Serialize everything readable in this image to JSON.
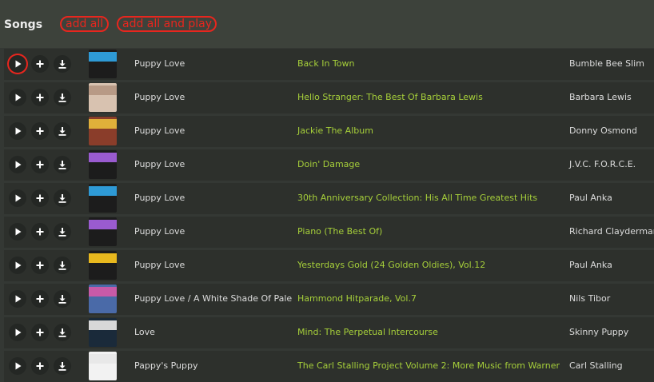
{
  "header": {
    "title": "Songs",
    "add_all_label": "add all",
    "add_all_play_label": "add all and play"
  },
  "rows": [
    {
      "song": "Puppy Love",
      "album": "Back In Town",
      "artist": "Bumble Bee Slim",
      "cover_color": "#2e9ad6",
      "cover_bg": "#1c1c1c"
    },
    {
      "song": "Puppy Love",
      "album": "Hello Stranger: The Best Of Barbara Lewis",
      "artist": "Barbara Lewis",
      "cover_color": "#b89a86",
      "cover_bg": "#d8c2b0"
    },
    {
      "song": "Puppy Love",
      "album": "Jackie The Album",
      "artist": "Donny Osmond",
      "cover_color": "#e0b03a",
      "cover_bg": "#8a3d2a"
    },
    {
      "song": "Puppy Love",
      "album": "Doin' Damage",
      "artist": "J.V.C. F.O.R.C.E.",
      "cover_color": "#9a5bd0",
      "cover_bg": "#1c1c1c"
    },
    {
      "song": "Puppy Love",
      "album": "30th Anniversary Collection: His All Time Greatest Hits",
      "artist": "Paul Anka",
      "cover_color": "#2e9ad6",
      "cover_bg": "#1c1c1c"
    },
    {
      "song": "Puppy Love",
      "album": "Piano (The Best Of)",
      "artist": "Richard Clayderman",
      "cover_color": "#9a5bd0",
      "cover_bg": "#1c1c1c"
    },
    {
      "song": "Puppy Love",
      "album": "Yesterdays Gold (24 Golden Oldies), Vol.12",
      "artist": "Paul Anka",
      "cover_color": "#e8b81e",
      "cover_bg": "#1c1c1c"
    },
    {
      "song": "Puppy Love / A White Shade Of Pale",
      "album": "Hammond Hitparade, Vol.7",
      "artist": "Nils Tibor",
      "cover_color": "#c85aa8",
      "cover_bg": "#4a6aa8"
    },
    {
      "song": "Love",
      "album": "Mind: The Perpetual Intercourse",
      "artist": "Skinny Puppy",
      "cover_color": "#d8d8d8",
      "cover_bg": "#1a2a3a"
    },
    {
      "song": "Pappy's Puppy",
      "album": "The Carl Stalling Project Volume 2: More Music from Warner",
      "artist": "Carl Stalling",
      "cover_color": "#e8e8e8",
      "cover_bg": "#f2f2f2"
    }
  ],
  "icons": {
    "play": "play-icon",
    "add": "plus-icon",
    "download": "download-icon"
  },
  "colors": {
    "accent_red": "#e8261e",
    "album_green": "#a6cf3a"
  }
}
